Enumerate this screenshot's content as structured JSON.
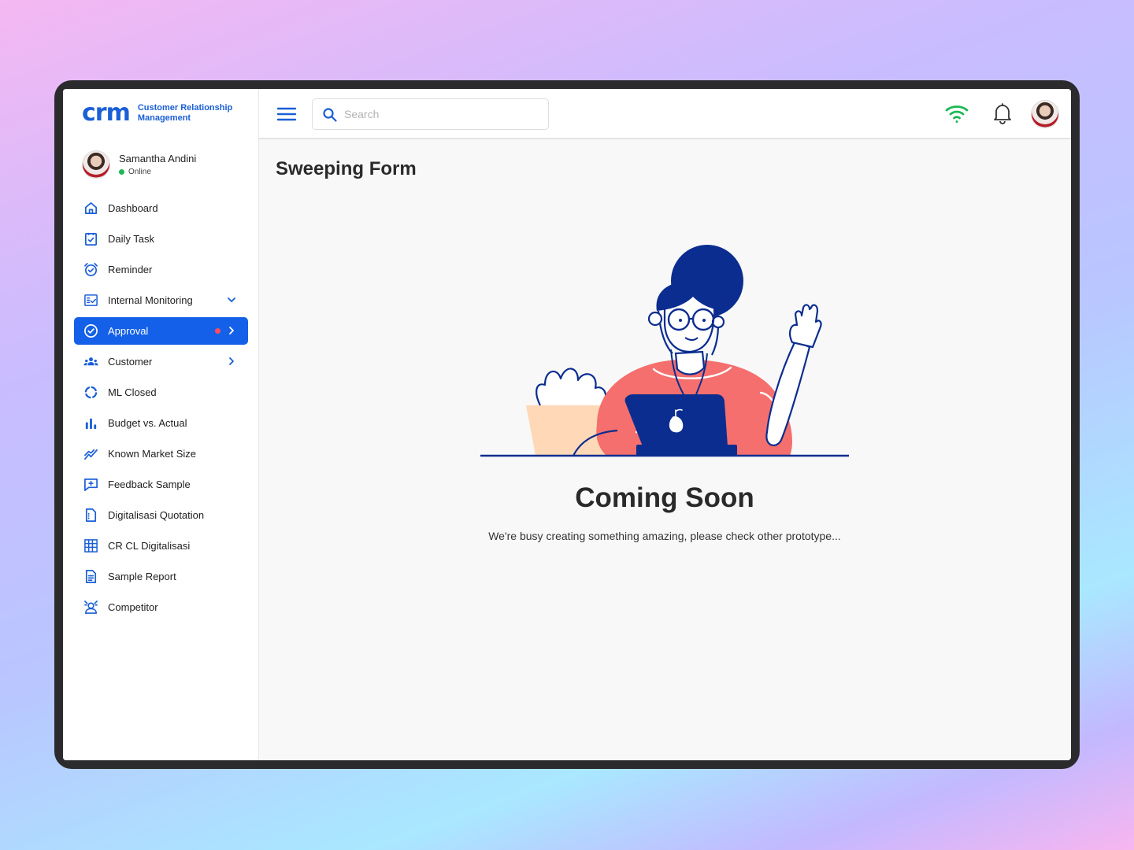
{
  "brand": {
    "logo": "crm",
    "name": "Customer Relationship Management"
  },
  "user": {
    "name": "Samantha Andini",
    "status": "Online"
  },
  "sidebar": {
    "items": [
      {
        "label": "Dashboard",
        "icon": "home-icon"
      },
      {
        "label": "Daily Task",
        "icon": "clipboard-check-icon"
      },
      {
        "label": "Reminder",
        "icon": "alarm-clock-icon"
      },
      {
        "label": "Internal Monitoring",
        "icon": "checklist-icon"
      },
      {
        "label": "Approval",
        "icon": "check-circle-icon"
      },
      {
        "label": "Customer",
        "icon": "users-icon"
      },
      {
        "label": "ML Closed",
        "icon": "progress-ring-icon"
      },
      {
        "label": "Budget vs. Actual",
        "icon": "bar-chart-icon"
      },
      {
        "label": "Known Market Size",
        "icon": "trend-line-icon"
      },
      {
        "label": "Feedback Sample",
        "icon": "message-plus-icon"
      },
      {
        "label": "Digitalisasi Quotation",
        "icon": "document-icon"
      },
      {
        "label": "CR CL Digitalisasi",
        "icon": "table-grid-icon"
      },
      {
        "label": "Sample Report",
        "icon": "report-icon"
      },
      {
        "label": "Competitor",
        "icon": "competitor-icon"
      }
    ]
  },
  "topbar": {
    "search_placeholder": "Search"
  },
  "main": {
    "title": "Sweeping Form",
    "coming_soon": "Coming Soon",
    "subtitle": "We're busy creating something amazing, please check other prototype..."
  },
  "colors": {
    "primary": "#1460e8",
    "navy": "#0b2d8f",
    "coral": "#f46f6d",
    "online": "#1db954",
    "alert": "#ff4d5e"
  }
}
